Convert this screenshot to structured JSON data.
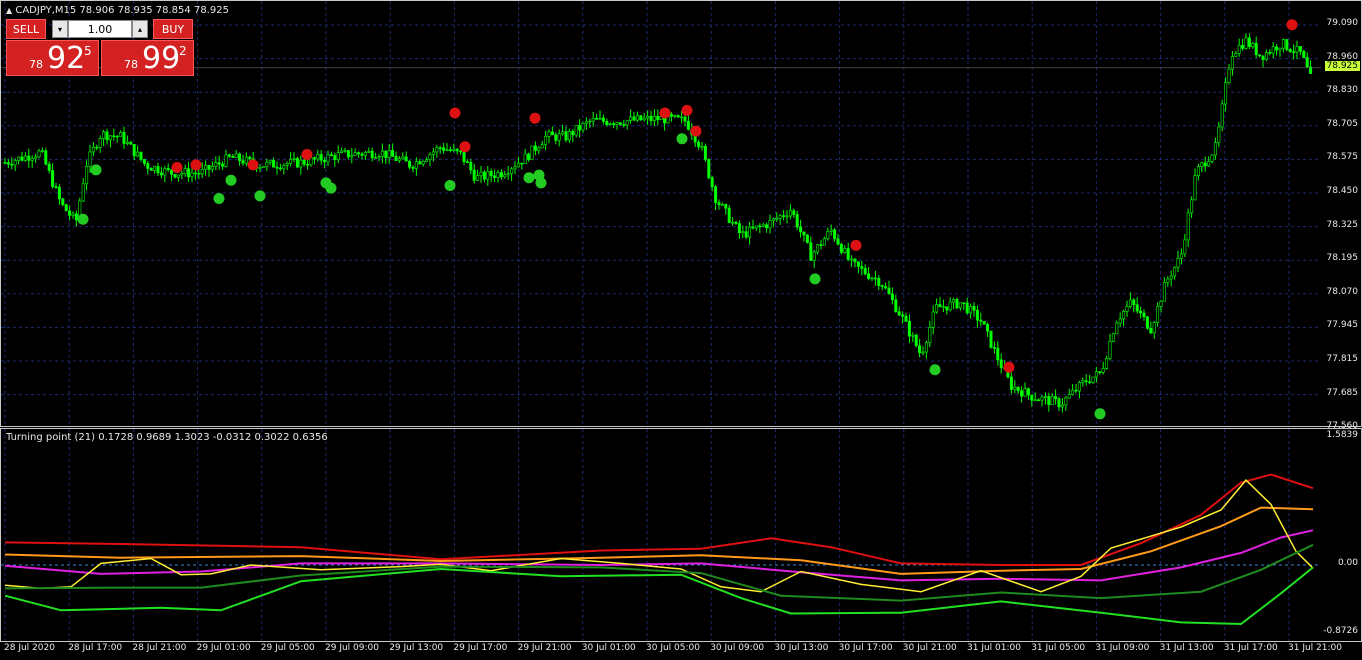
{
  "chart": {
    "symbol_line": "CADJPY,M15  78.906 78.935 78.854 78.925",
    "current_price": "78.925",
    "price_axis": [
      "79.090",
      "78.960",
      "78.830",
      "78.705",
      "78.575",
      "78.450",
      "78.325",
      "78.195",
      "78.070",
      "77.945",
      "77.815",
      "77.685",
      "77.560"
    ],
    "colors": {
      "background": "#000000",
      "candles": "#00ff00",
      "grid": "#1e2a6b",
      "signal_buy": "#22cc22",
      "signal_sell": "#dd1111"
    }
  },
  "trade_panel": {
    "sell_label": "SELL",
    "buy_label": "BUY",
    "lot_value": "1.00",
    "down_arrow": "▾",
    "up_arrow": "▴",
    "sell_big": "78",
    "sell_main": "92",
    "sell_sup": "5",
    "buy_big": "78",
    "buy_main": "99",
    "buy_sup": "2"
  },
  "indicator": {
    "title": "Turning point (21) 0.1728 0.9689 1.3023 -0.0312 0.3022 0.6356",
    "axis": [
      "1.5839",
      "0.00",
      "-0.8726"
    ],
    "colors": {
      "red": "#e01010",
      "orange": "#ff9a1a",
      "magenta": "#e020e0",
      "yellow": "#ffee33",
      "dark_green": "#1f8a1f",
      "green": "#22e022",
      "zero_line": "#3a7fd0"
    }
  },
  "time_axis": [
    "28 Jul 2020",
    "28 Jul 17:00",
    "28 Jul 21:00",
    "29 Jul 01:00",
    "29 Jul 05:00",
    "29 Jul 09:00",
    "29 Jul 13:00",
    "29 Jul 17:00",
    "29 Jul 21:00",
    "30 Jul 01:00",
    "30 Jul 05:00",
    "30 Jul 09:00",
    "30 Jul 13:00",
    "30 Jul 17:00",
    "30 Jul 21:00",
    "31 Jul 01:00",
    "31 Jul 05:00",
    "31 Jul 09:00",
    "31 Jul 13:00",
    "31 Jul 17:00",
    "31 Jul 21:00"
  ]
}
